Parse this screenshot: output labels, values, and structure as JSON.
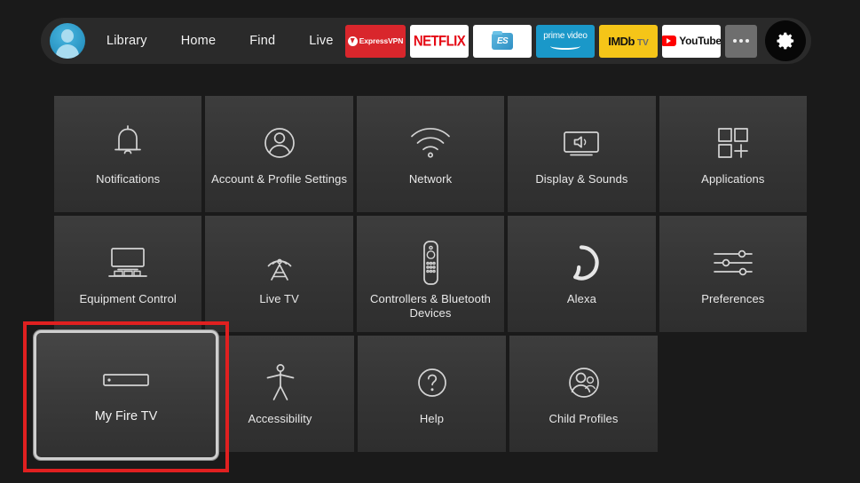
{
  "nav": {
    "avatar_name": "profile-avatar",
    "links": [
      {
        "label": "Library"
      },
      {
        "label": "Home"
      },
      {
        "label": "Find"
      },
      {
        "label": "Live"
      }
    ],
    "apps": [
      {
        "name": "expressvpn",
        "label": "ExpressVPN",
        "color": "#d9262c"
      },
      {
        "name": "netflix",
        "label": "NETFLIX",
        "color": "#ffffff"
      },
      {
        "name": "es-file-explorer",
        "label": "ES",
        "color": "#ffffff"
      },
      {
        "name": "prime-video",
        "label": "prime video",
        "color": "#1a98c9"
      },
      {
        "name": "imdb-tv",
        "label": "IMDb",
        "label2": "TV",
        "color": "#f5c518"
      },
      {
        "name": "youtube",
        "label": "YouTube",
        "color": "#ffffff"
      }
    ],
    "more_label": "…",
    "settings_label": "Settings"
  },
  "grid": {
    "rows": [
      [
        {
          "icon": "bell-icon",
          "label": "Notifications"
        },
        {
          "icon": "account-person-icon",
          "label": "Account & Profile Settings"
        },
        {
          "icon": "wifi-icon",
          "label": "Network"
        },
        {
          "icon": "tv-speaker-icon",
          "label": "Display & Sounds"
        },
        {
          "icon": "app-grid-plus-icon",
          "label": "Applications"
        }
      ],
      [
        {
          "icon": "tv-stand-icon",
          "label": "Equipment Control"
        },
        {
          "icon": "antenna-tower-icon",
          "label": "Live TV"
        },
        {
          "icon": "remote-control-icon",
          "label": "Controllers & Bluetooth Devices"
        },
        {
          "icon": "alexa-ring-icon",
          "label": "Alexa"
        },
        {
          "icon": "sliders-icon",
          "label": "Preferences"
        }
      ],
      [
        {
          "icon": "accessibility-icon",
          "label": "Accessibility"
        },
        {
          "icon": "question-mark-icon",
          "label": "Help"
        },
        {
          "icon": "child-profiles-icon",
          "label": "Child Profiles"
        }
      ]
    ],
    "selected": {
      "icon": "fire-tv-stick-icon",
      "label": "My Fire TV",
      "highlight_color": "#e02020"
    }
  }
}
